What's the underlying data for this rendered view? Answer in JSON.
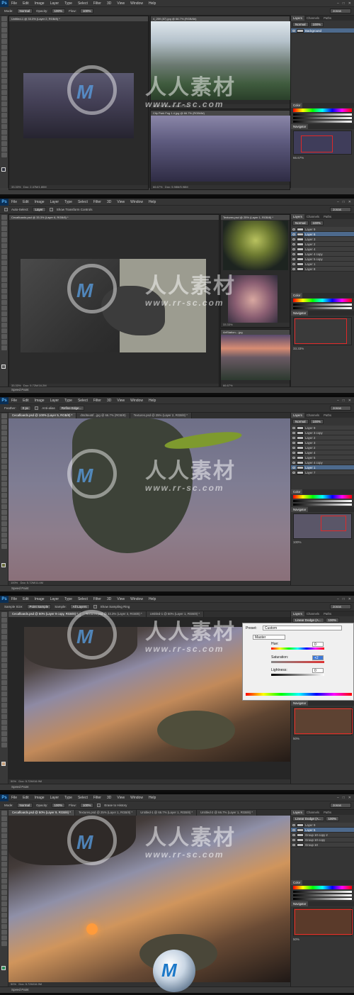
{
  "menu": [
    "File",
    "Edit",
    "Image",
    "Layer",
    "Type",
    "Select",
    "Filter",
    "3D",
    "View",
    "Window",
    "Help"
  ],
  "ps_logo": "Ps",
  "watermark": {
    "chars": "人人素材",
    "url": "www.rr-sc.com",
    "logo_letter": "M"
  },
  "screens": [
    {
      "options": [
        {
          "label": "Mode:",
          "value": "Normal"
        },
        {
          "label": "Opacity:",
          "value": "100%"
        },
        {
          "label": "Flow:",
          "value": "100%"
        }
      ],
      "workspace": "Jonas",
      "docs": [
        {
          "tab": "Untitled-1 @ 33.3% (Layer 2, RGB/8) *",
          "status": "Doc: 2.47M/1.80M",
          "zoom": "33.33%"
        },
        {
          "tab": "4_259 (87).jpg @ 66.7% (RGB/8#)",
          "status": "Doc: 27.8M/27.8M",
          "zoom": "66.67%"
        },
        {
          "tab": "City Park Fog 1.4.jpg @ 66.7% (RGB/8#)",
          "status": "Doc: 5.98M/5.98M",
          "zoom": "66.67%"
        }
      ],
      "layers": [
        {
          "name": "Background",
          "selected": true
        }
      ],
      "panel_tabs": [
        "Layers",
        "Channels",
        "Paths"
      ],
      "blend": "Normal",
      "opacity": "100%",
      "color_tab": "Color",
      "nav_tab": "Navigator",
      "nav_zoom": "66.67%"
    },
    {
      "options": [
        {
          "label": "Auto-Select:",
          "value": "Layer"
        },
        {
          "label": "Show Transform Controls",
          "value": ""
        }
      ],
      "workspace": "Jonas",
      "docs": [
        {
          "tab": "Cecafloards.psd @ 33.3% (Layer 6, RGB/8) *",
          "status": "Doc: 5.72M/16.2M",
          "zoom": "33.33%"
        },
        {
          "tab": "Textures.psd @ 25% (Layer 1, RGB/8) *",
          "status": "",
          "zoom": "33.33%"
        },
        {
          "tab": "ArtStation-...jpg",
          "status": "",
          "zoom": "66.67%"
        }
      ],
      "layers": [
        {
          "name": "Layer 9"
        },
        {
          "name": "Layer 6",
          "selected": true
        },
        {
          "name": "Layer 3"
        },
        {
          "name": "Layer 2"
        },
        {
          "name": "Layer 4"
        },
        {
          "name": "Layer 4 copy"
        },
        {
          "name": "Layer 5 copy"
        },
        {
          "name": "Layer 1"
        },
        {
          "name": "Layer 8"
        }
      ],
      "panel_tabs": [
        "Layers",
        "Channels",
        "Paths"
      ],
      "blend": "Normal",
      "opacity": "100%",
      "color_tab": "Color",
      "nav_tab": "Navigator",
      "nav_zoom": "33.33%",
      "status_bar": "Speed Paint"
    },
    {
      "options": [
        {
          "label": "Feather:",
          "value": "0 px"
        },
        {
          "label": "Anti-alias",
          "value": ""
        },
        {
          "label": "Refine Edge...",
          "value": ""
        }
      ],
      "workspace": "Jonas",
      "tabs": [
        "Cecafloards.psd @ 100% (Layer 5, RGB/8) *",
        "dt4d6ea5f...jpg @ 66.7% (RGB/8)",
        "Textures.psd @ 25% (Layer 2, RGB/8) *"
      ],
      "docs": [
        {
          "tab": "",
          "status": "Doc: 5.72M/11.4M",
          "zoom": "100%"
        }
      ],
      "layers": [
        {
          "name": "Layer 9"
        },
        {
          "name": "Layer 3 copy"
        },
        {
          "name": "Layer 2"
        },
        {
          "name": "Layer 3"
        },
        {
          "name": "Layer 2"
        },
        {
          "name": "Layer 4"
        },
        {
          "name": "Layer 5"
        },
        {
          "name": "Layer 4 copy"
        },
        {
          "name": "Layer 1",
          "selected": true
        },
        {
          "name": "Layer 7"
        }
      ],
      "panel_tabs": [
        "Layers",
        "Channels",
        "Paths"
      ],
      "blend": "Normal",
      "opacity": "100%",
      "color_tab": "Color",
      "nav_tab": "Navigator",
      "nav_zoom": "100%",
      "status_bar": "Speed Paint"
    },
    {
      "options": [
        {
          "label": "Sample Size:",
          "value": "Point Sample"
        },
        {
          "label": "Sample:",
          "value": "All Layers"
        },
        {
          "label": "Show Sampling Ring",
          "value": ""
        }
      ],
      "workspace": "Jonas",
      "tabs": [
        "Cecafloards.psd @ 50% (Layer 9 copy, RGB/8) *",
        "Textures.psd @ 33.3% (Layer 3, RGB/8) *",
        "Untitled-1 @ 50% (Layer 1, RGB/8) *"
      ],
      "docs": [
        {
          "tab": "",
          "status": "Doc: 5.72M/16.9M",
          "zoom": "50%"
        }
      ],
      "layers": [
        {
          "name": "Layer 9 copy",
          "selected": true
        },
        {
          "name": "Layer 9"
        }
      ],
      "panel_tabs": [
        "Layers",
        "Channels",
        "Paths"
      ],
      "blend": "Linear Dodge (A...",
      "opacity": "100%",
      "color_tab": "Color",
      "nav_tab": "Navigator",
      "nav_zoom": "50%",
      "status_bar": "Speed Paint",
      "hue_dialog": {
        "preset_label": "Preset:",
        "preset": "Custom",
        "channel": "Master",
        "hue_label": "Hue:",
        "hue": "0",
        "sat_label": "Saturation:",
        "sat": "+2",
        "light_label": "Lightness:",
        "light": "0"
      }
    },
    {
      "options": [
        {
          "label": "Mode:",
          "value": "Normal"
        },
        {
          "label": "Opacity:",
          "value": "100%"
        },
        {
          "label": "Flow:",
          "value": "100%"
        },
        {
          "label": "Erase to History",
          "value": ""
        }
      ],
      "workspace": "Jonas",
      "tabs": [
        "Cecafloards.psd @ 50% (Layer 9, RGB/8) *",
        "Textures.psd @ 25% (Layer 1, RGB/8) *",
        "Untitled-1 @ 66.7% (Layer 1, RGB/8) *",
        "Untitled-2 @ 66.7% (Layer 1, RGB/8) *"
      ],
      "docs": [
        {
          "tab": "",
          "status": "Doc: 5.72M/16.9M",
          "zoom": "50%"
        }
      ],
      "layers": [
        {
          "name": "Layer 9"
        },
        {
          "name": "Layer 5",
          "selected": true
        },
        {
          "name": "Group 10 copy 2"
        },
        {
          "name": "Group 10 copy"
        },
        {
          "name": "Group 10"
        }
      ],
      "panel_tabs": [
        "Layers",
        "Channels",
        "Paths"
      ],
      "blend": "Linear Dodge (A...",
      "opacity": "100%",
      "color_tab": "Color",
      "nav_tab": "Navigator",
      "nav_zoom": "50%",
      "status_bar": "Speed Paint"
    }
  ],
  "colors": {
    "menubar": "#353535",
    "panel": "#353535",
    "workarea": "#262626",
    "selected_layer": "#4d6a8d",
    "accent_red": "#e02828"
  },
  "icons": [
    "photoshop-logo-icon",
    "minimize-icon",
    "maximize-icon",
    "close-icon",
    "eye-icon",
    "watermark-logo-icon"
  ]
}
